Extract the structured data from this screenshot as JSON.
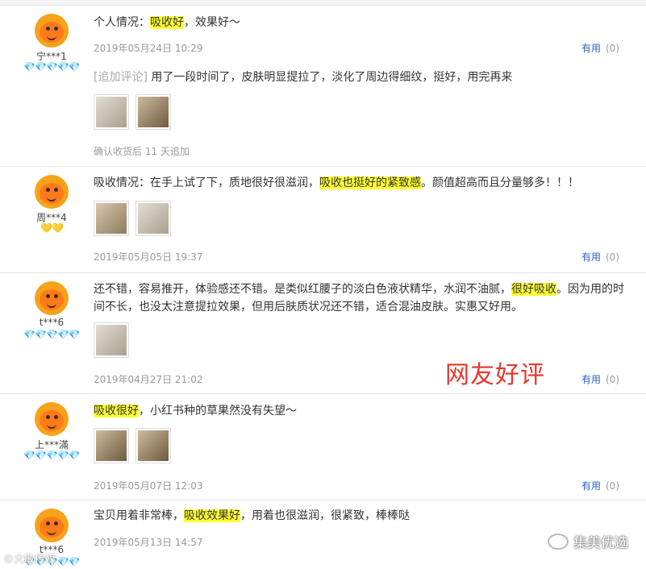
{
  "reviews": [
    {
      "username": "宁***1",
      "badges": "💎💎💎💎💎",
      "text_before": "个人情况：",
      "text_hl": "吸收好",
      "text_after": "，效果好～",
      "date": "2019年05月24日 10:29",
      "helpful_label": "有用",
      "helpful_count": "(0)",
      "append_label": "[追加评论]",
      "append_text": "用了一段时间了，皮肤明显提拉了，淡化了周边得细纹，挺好，用完再来",
      "append_meta": "确认收货后 11 天追加"
    },
    {
      "username": "周***4",
      "badges": "💛💛",
      "text_before": "吸收情况：在手上试了下，质地很好很滋润，",
      "text_hl": "吸收也挺好的紧致感",
      "text_after": "。颜值超高而且分量够多！！！",
      "date": "2019年05月05日 19:37",
      "helpful_label": "有用",
      "helpful_count": "(0)"
    },
    {
      "username": "t***6",
      "badges": "💎💎💎💎💎",
      "text_before": "还不错，容易推开，体验感还不错。是类似红腰子的淡白色液状精华，水润不油腻，",
      "text_hl": "很好吸收",
      "text_after": "。因为用的时间不长，也没太注意提拉效果，但用后肤质状况还不错，适合混油皮肤。实惠又好用。",
      "date": "2019年04月27日 21:02",
      "helpful_label": "有用",
      "helpful_count": "(0)"
    },
    {
      "username": "上***滿",
      "badges": "💎💎💎💎💎",
      "text_before": "",
      "text_hl": "吸收很好",
      "text_after": "，小红书种的草果然没有失望～",
      "date": "2019年05月07日 12:03",
      "helpful_label": "有用",
      "helpful_count": "(0)"
    },
    {
      "username": "t***6",
      "badges": "💎💎💎💎💎",
      "text_before": "宝贝用着非常棒，",
      "text_hl": "吸收效果好",
      "text_after": "，用着也很滋润，很紧致，棒棒哒",
      "date": "2019年05月13日 14:57",
      "helpful_label": "",
      "helpful_count": ""
    }
  ],
  "overlay_text": "网友好评",
  "watermark_right": "集美优选",
  "watermark_left": "©大敏传媒",
  "colors": {
    "highlight": "#ffff33",
    "link": "#2a63c4",
    "overlay": "#e8362c",
    "avatar": "#f7a21a"
  }
}
